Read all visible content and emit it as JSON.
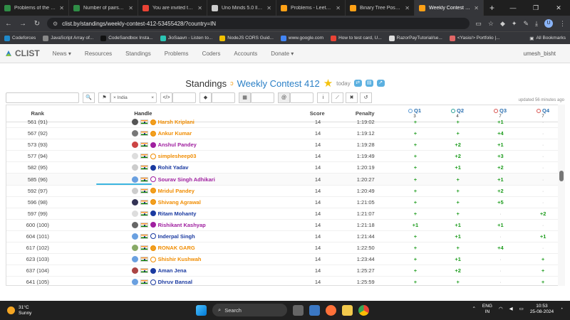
{
  "browser": {
    "tabs": [
      {
        "title": "Problems of the Day |",
        "color": "#2f8d46",
        "active": false
      },
      {
        "title": "Number of pairs | Pr",
        "color": "#2f8d46",
        "active": false
      },
      {
        "title": "You are invited to lo",
        "color": "#ea4335",
        "active": false
      },
      {
        "title": "Uno Minds 5.0 ll Re",
        "color": "#cccccc",
        "active": false
      },
      {
        "title": "Problems - LeetCode",
        "color": "#ffa116",
        "active": false
      },
      {
        "title": "Binary Tree Postorde",
        "color": "#ffa116",
        "active": false
      },
      {
        "title": "Weekly Contest 412",
        "color": "#ffa116",
        "active": true
      }
    ],
    "new_tab": "+",
    "url": "clist.by/standings/weekly-contest-412-53455428/?country=IN",
    "profile_initial": "U",
    "bookmarks": [
      {
        "label": "Codeforces",
        "color": "#1f8acb"
      },
      {
        "label": "JavaScript Array of...",
        "color": "#888888"
      },
      {
        "label": "CodeSandbox Insta...",
        "color": "#111111"
      },
      {
        "label": "JioSaavn - Listen to...",
        "color": "#2bc5b4"
      },
      {
        "label": "NodeJS CORS Guid...",
        "color": "#f0c000"
      },
      {
        "label": "www.google.com",
        "color": "#4285f4"
      },
      {
        "label": "How to test card, U...",
        "color": "#ea4335"
      },
      {
        "label": "RazorPayTutorial/se...",
        "color": "#dddddd"
      },
      {
        "label": "<Yasio/> Portfolio |...",
        "color": "#e06666"
      }
    ],
    "all_bookmarks": "All Bookmarks"
  },
  "site": {
    "logo": "CLIST",
    "nav": [
      "News ▾",
      "Resources",
      "Standings",
      "Problems",
      "Coders",
      "Accounts",
      "Donate ▾"
    ],
    "user": "umesh_bisht"
  },
  "page": {
    "title_prefix": "Standings",
    "contest": "Weekly Contest 412",
    "today": "today",
    "country_chip": "× India",
    "country_clear": "×",
    "updated": "updated 56 minutes ago"
  },
  "table": {
    "headers": {
      "rank": "Rank",
      "handle": "Handle",
      "score": "Score",
      "penalty": "Penalty"
    },
    "questions": [
      {
        "label": "Q1",
        "count": "3",
        "color": "#5b9bd5"
      },
      {
        "label": "Q2",
        "count": "4",
        "color": "#2aa198"
      },
      {
        "label": "Q3",
        "count": "7",
        "color": "#d9534f"
      },
      {
        "label": "Q4",
        "count": "7",
        "color": "#d9534f"
      }
    ],
    "rows": [
      {
        "rank": "561 (91)",
        "handle": "Harsh Kriplani",
        "color": "#f08c00",
        "level": "#f0a020",
        "score": "14",
        "penalty": "1:19:02",
        "q": [
          "+",
          "+",
          "+1",
          "·"
        ]
      },
      {
        "rank": "567 (92)",
        "handle": "Ankur Kumar",
        "color": "#f08c00",
        "level": "#f0a020",
        "score": "14",
        "penalty": "1:19:12",
        "q": [
          "+",
          "+",
          "+4",
          "·"
        ]
      },
      {
        "rank": "573 (93)",
        "handle": "Anshul Pandey",
        "color": "#a020a0",
        "level": "#a020a0",
        "score": "14",
        "penalty": "1:19:28",
        "q": [
          "+",
          "+2",
          "+1",
          "·"
        ]
      },
      {
        "rank": "577 (94)",
        "handle": "simplesheep03",
        "color": "#f08c00",
        "level": "#ffffff",
        "score": "14",
        "penalty": "1:19:49",
        "q": [
          "+",
          "+2",
          "+3",
          "·"
        ]
      },
      {
        "rank": "582 (95)",
        "handle": "Rohit Yadav",
        "color": "#1a3aa0",
        "level": "#1a3aa0",
        "score": "14",
        "penalty": "1:20:19",
        "q": [
          "+",
          "+1",
          "+2",
          "·"
        ]
      },
      {
        "rank": "585 (96)",
        "handle": "Sourav Singh Adhikari",
        "color": "#a020a0",
        "level": "#ffffff",
        "score": "14",
        "penalty": "1:20:27",
        "q": [
          "+",
          "+",
          "+1",
          "·"
        ]
      },
      {
        "rank": "592 (97)",
        "handle": "Mridul Pandey",
        "color": "#f08c00",
        "level": "#f0a020",
        "score": "14",
        "penalty": "1:20:49",
        "q": [
          "+",
          "+",
          "+2",
          "·"
        ]
      },
      {
        "rank": "596 (98)",
        "handle": "Shivang Agrawal",
        "color": "#f08c00",
        "level": "#f0a020",
        "score": "14",
        "penalty": "1:21:05",
        "q": [
          "+",
          "+",
          "+5",
          "·"
        ]
      },
      {
        "rank": "597 (99)",
        "handle": "Ritam Mohanty",
        "color": "#1a3aa0",
        "level": "#1a3aa0",
        "score": "14",
        "penalty": "1:21:07",
        "q": [
          "+",
          "+",
          "·",
          "+2"
        ]
      },
      {
        "rank": "600 (100)",
        "handle": "Rishikant Kashyap",
        "color": "#a020a0",
        "level": "#a020a0",
        "score": "14",
        "penalty": "1:21:18",
        "q": [
          "+1",
          "+1",
          "+1",
          "·"
        ]
      },
      {
        "rank": "604 (101)",
        "handle": "Inderpal Singh",
        "color": "#1a3aa0",
        "level": "#ffffff",
        "score": "14",
        "penalty": "1:21:44",
        "q": [
          "+",
          "+1",
          "·",
          "+1"
        ]
      },
      {
        "rank": "617 (102)",
        "handle": "RONAK GARG",
        "color": "#f08c00",
        "level": "#f0a020",
        "score": "14",
        "penalty": "1:22:50",
        "q": [
          "+",
          "+",
          "+4",
          "·"
        ]
      },
      {
        "rank": "623 (103)",
        "handle": "Shishir Kushwah",
        "color": "#f08c00",
        "level": "#ffffff",
        "score": "14",
        "penalty": "1:23:44",
        "q": [
          "+",
          "+1",
          "·",
          "+"
        ]
      },
      {
        "rank": "637 (104)",
        "handle": "Aman Jena",
        "color": "#1a3aa0",
        "level": "#1a3aa0",
        "score": "14",
        "penalty": "1:25:27",
        "q": [
          "+",
          "+2",
          "·",
          "+"
        ]
      },
      {
        "rank": "641 (105)",
        "handle": "Dhruv Bansal",
        "color": "#1a3aa0",
        "level": "#ffffff",
        "score": "14",
        "penalty": "1:25:59",
        "q": [
          "+",
          "+",
          "·",
          "+"
        ]
      }
    ]
  },
  "taskbar": {
    "temp": "31°C",
    "weather": "Sunny",
    "search": "Search",
    "lang1": "ENG",
    "lang2": "IN",
    "time": "10:53",
    "date": "25-08-2024"
  }
}
